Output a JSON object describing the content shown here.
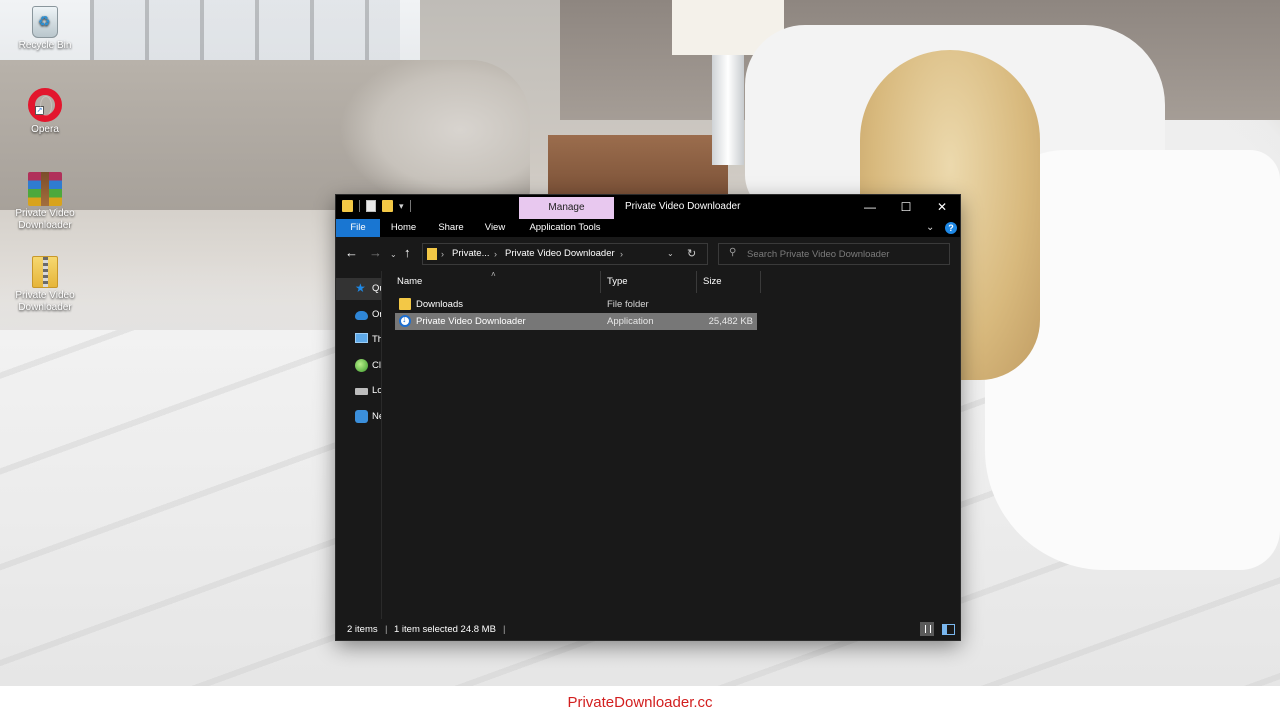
{
  "desktop": {
    "icons": [
      {
        "label": "Recycle Bin",
        "icon": "recycle-bin-icon"
      },
      {
        "label": "Opera",
        "icon": "opera-icon"
      },
      {
        "label": "Private Video Downloader",
        "icon": "winrar-archive-icon"
      },
      {
        "label": "Private Video Downloader",
        "icon": "zip-folder-icon"
      }
    ]
  },
  "window": {
    "title": "Private Video Downloader",
    "manage_tab": "Manage",
    "controls": {
      "minimize": "—",
      "maximize": "☐",
      "close": "✕"
    }
  },
  "ribbon": {
    "tabs": [
      "File",
      "Home",
      "Share",
      "View",
      "Application Tools"
    ],
    "active_tab": "File",
    "accent_color": "#1976d2",
    "manage_color": "#e8c8ef"
  },
  "navigation": {
    "back": "←",
    "forward": "→",
    "recent": "⌄",
    "up": "↑",
    "breadcrumb": [
      "Private...",
      "Private Video Downloader"
    ],
    "search_placeholder": "Search Private Video Downloader"
  },
  "nav_pane": {
    "items": [
      {
        "label": "Qu",
        "icon": "star-icon",
        "selected": true
      },
      {
        "label": "On",
        "icon": "cloud-icon"
      },
      {
        "label": "Th",
        "icon": "computer-icon"
      },
      {
        "label": "Cl",
        "icon": "globe-icon"
      },
      {
        "label": "Lo",
        "icon": "drive-icon"
      },
      {
        "label": "Ne",
        "icon": "network-icon"
      }
    ]
  },
  "file_list": {
    "columns": [
      "Name",
      "Type",
      "Size"
    ],
    "rows": [
      {
        "name": "Downloads",
        "type": "File folder",
        "size": "",
        "icon": "folder-icon",
        "selected": false
      },
      {
        "name": "Private Video Downloader",
        "type": "Application",
        "size": "25,482 KB",
        "icon": "application-icon",
        "selected": true
      }
    ]
  },
  "status": {
    "item_count": "2 items",
    "selection": "1 item selected  24.8 MB"
  },
  "footer": {
    "text": "PrivateDownloader.cc",
    "color": "#d21f1f"
  }
}
